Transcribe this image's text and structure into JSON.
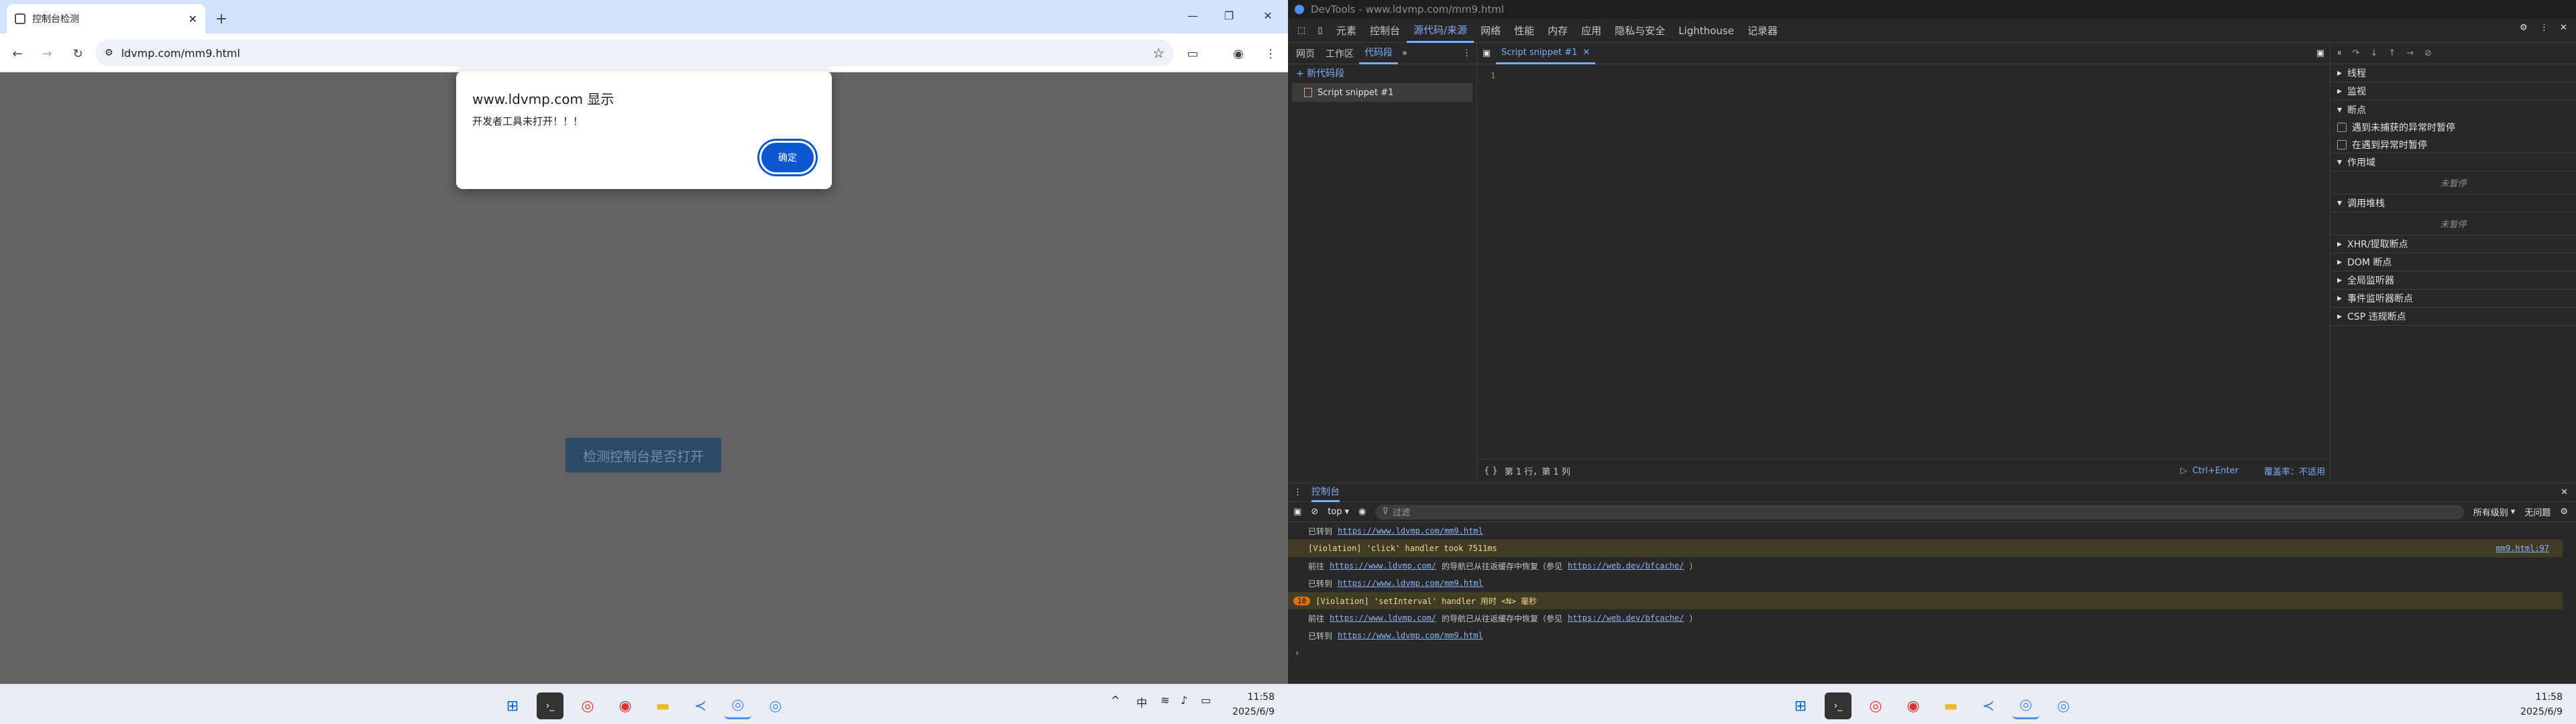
{
  "browser": {
    "tab_title": "控制台检测",
    "url": "ldvmp.com/mm9.html",
    "dialog": {
      "title": "www.ldvmp.com 显示",
      "message": "开发者工具未打开！！！",
      "ok": "确定"
    },
    "page_button": "检测控制台是否打开"
  },
  "devtools": {
    "title": "DevTools - www.ldvmp.com/mm9.html",
    "main_tabs": [
      "元素",
      "控制台",
      "源代码/来源",
      "网络",
      "性能",
      "内存",
      "应用",
      "隐私与安全",
      "Lighthouse",
      "记录器"
    ],
    "active_main_tab": "源代码/来源",
    "left_tabs": [
      "网页",
      "工作区",
      "代码段"
    ],
    "new_snippet": "+ 新代码段",
    "snippet_file": "Script snippet #1",
    "editor_tab": "Script snippet #1",
    "line_number": "1",
    "status_pos": "第 1 行，第 1 列",
    "status_run": "Ctrl+Enter",
    "status_coverage": "覆盖率：不适用",
    "right": {
      "threads": "线程",
      "watch": "监视",
      "breakpoints": "断点",
      "bp1": "遇到未捕获的异常时暂停",
      "bp2": "在遇到异常时暂停",
      "scope": "作用域",
      "not_paused": "未暂停",
      "call_stack": "调用堆栈",
      "not_paused2": "未暂停",
      "xhr": "XHR/提取断点",
      "dom": "DOM 断点",
      "global": "全局监听器",
      "event": "事件监听器断点",
      "csp": "CSP 违规断点"
    },
    "drawer": {
      "tab": "控制台",
      "context": "top",
      "filter": "过滤",
      "levels": "所有级别",
      "issues": "无问题",
      "lines": [
        {
          "type": "nav",
          "prefix": "已转到",
          "link": "https://www.ldvmp.com/mm9.html"
        },
        {
          "type": "warn",
          "text": "[Violation] 'click' handler took 7511ms",
          "src": "mm9.html:97"
        },
        {
          "type": "info",
          "prefix": "前往",
          "link": "https://www.ldvmp.com/",
          "mid": "的导航已从往返缓存中恢复（参见",
          "link2": "https://web.dev/bfcache/",
          "end": "）"
        },
        {
          "type": "nav",
          "prefix": "已转到",
          "link": "https://www.ldvmp.com/mm9.html"
        },
        {
          "type": "warn",
          "badge": "10",
          "text": "[Violation] 'setInterval' handler 用时 <N> 毫秒"
        },
        {
          "type": "info",
          "prefix": "前往",
          "link": "https://www.ldvmp.com/",
          "mid": "的导航已从往返缓存中恢复（参见",
          "link2": "https://web.dev/bfcache/",
          "end": "）"
        },
        {
          "type": "nav",
          "prefix": "已转到",
          "link": "https://www.ldvmp.com/mm9.html"
        }
      ],
      "prompt": "›"
    }
  },
  "taskbar": {
    "time": "11:58",
    "date": "2025/6/9",
    "ime": "中"
  }
}
